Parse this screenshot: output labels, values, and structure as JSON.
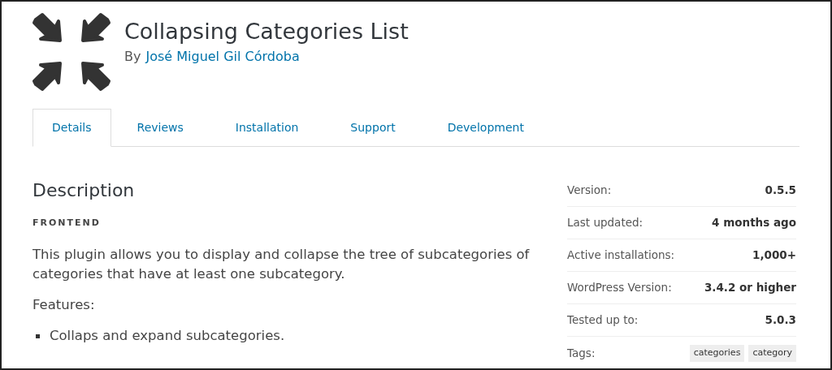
{
  "plugin": {
    "title": "Collapsing Categories List",
    "byline_prefix": "By",
    "author": "José Miguel Gil Córdoba"
  },
  "tabs": [
    {
      "label": "Details",
      "selected": true
    },
    {
      "label": "Reviews",
      "selected": false
    },
    {
      "label": "Installation",
      "selected": false
    },
    {
      "label": "Support",
      "selected": false
    },
    {
      "label": "Development",
      "selected": false
    }
  ],
  "description": {
    "heading": "Description",
    "subheading": "FRONTEND",
    "paragraph": "This plugin allows you to display and collapse the tree of subcategories of categories that have at least one subcategory.",
    "features_label": "Features:",
    "features": [
      "Collaps and expand subcategories."
    ]
  },
  "meta": [
    {
      "label": "Version:",
      "value": "0.5.5"
    },
    {
      "label": "Last updated:",
      "value": "4 months ago"
    },
    {
      "label": "Active installations:",
      "value": "1,000+"
    },
    {
      "label": "WordPress Version:",
      "value": "3.4.2 or higher"
    },
    {
      "label": "Tested up to:",
      "value": "5.0.3"
    }
  ],
  "tags": {
    "label": "Tags:",
    "items": [
      "categories",
      "category"
    ]
  }
}
